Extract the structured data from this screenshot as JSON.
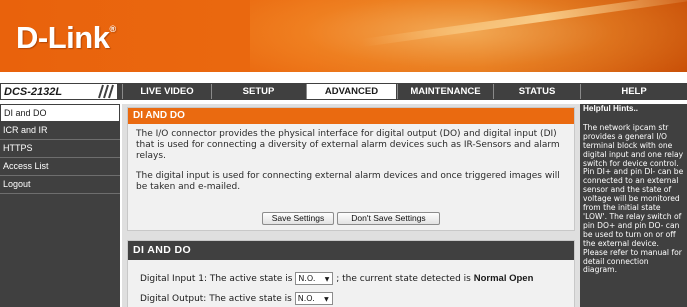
{
  "brand": {
    "logo": "D-Link",
    "reg": "®"
  },
  "model": "DCS-2132L",
  "nav": {
    "tabs": [
      {
        "label": "LIVE VIDEO"
      },
      {
        "label": "SETUP"
      },
      {
        "label": "ADVANCED"
      },
      {
        "label": "MAINTENANCE"
      },
      {
        "label": "STATUS"
      },
      {
        "label": "HELP"
      }
    ],
    "active": "ADVANCED"
  },
  "sidebar": {
    "items": [
      {
        "label": "DI and DO"
      },
      {
        "label": "ICR and IR"
      },
      {
        "label": "HTTPS"
      },
      {
        "label": "Access List"
      },
      {
        "label": "Logout"
      }
    ],
    "active": "DI and DO"
  },
  "section1": {
    "title": "DI AND DO",
    "para1": "The I/O connector provides the physical interface for digital output (DO) and digital input (DI) that is used for connecting a diversity of external alarm devices such as IR-Sensors and alarm relays.",
    "para2": "The digital input is used for connecting external alarm devices and once triggered images will be taken and e-mailed.",
    "save_label": "Save Settings",
    "nosave_label": "Don't Save Settings"
  },
  "section2": {
    "title": "DI AND DO",
    "input_prefix": "Digital Input 1: The active state is",
    "input_value": "N.O.",
    "input_middle": "; the current state detected is",
    "input_state": "Normal Open",
    "output_prefix": "Digital Output: The active state is",
    "output_value": "N.O."
  },
  "hints": {
    "title": "Helpful Hints..",
    "text": "The network ipcam str provides a general I/O terminal block with one digital input and one relay switch for device control. Pin DI+ and pin DI- can be connected to an external sensor and the state of voltage will be monitored from the initial state 'LOW'. The relay switch of pin DO+ and pin DO- can be used to turn on or off the external device. Please refer to manual for detail connection diagram."
  },
  "colors": {
    "accent": "#ea6a10",
    "dark": "#404040"
  }
}
